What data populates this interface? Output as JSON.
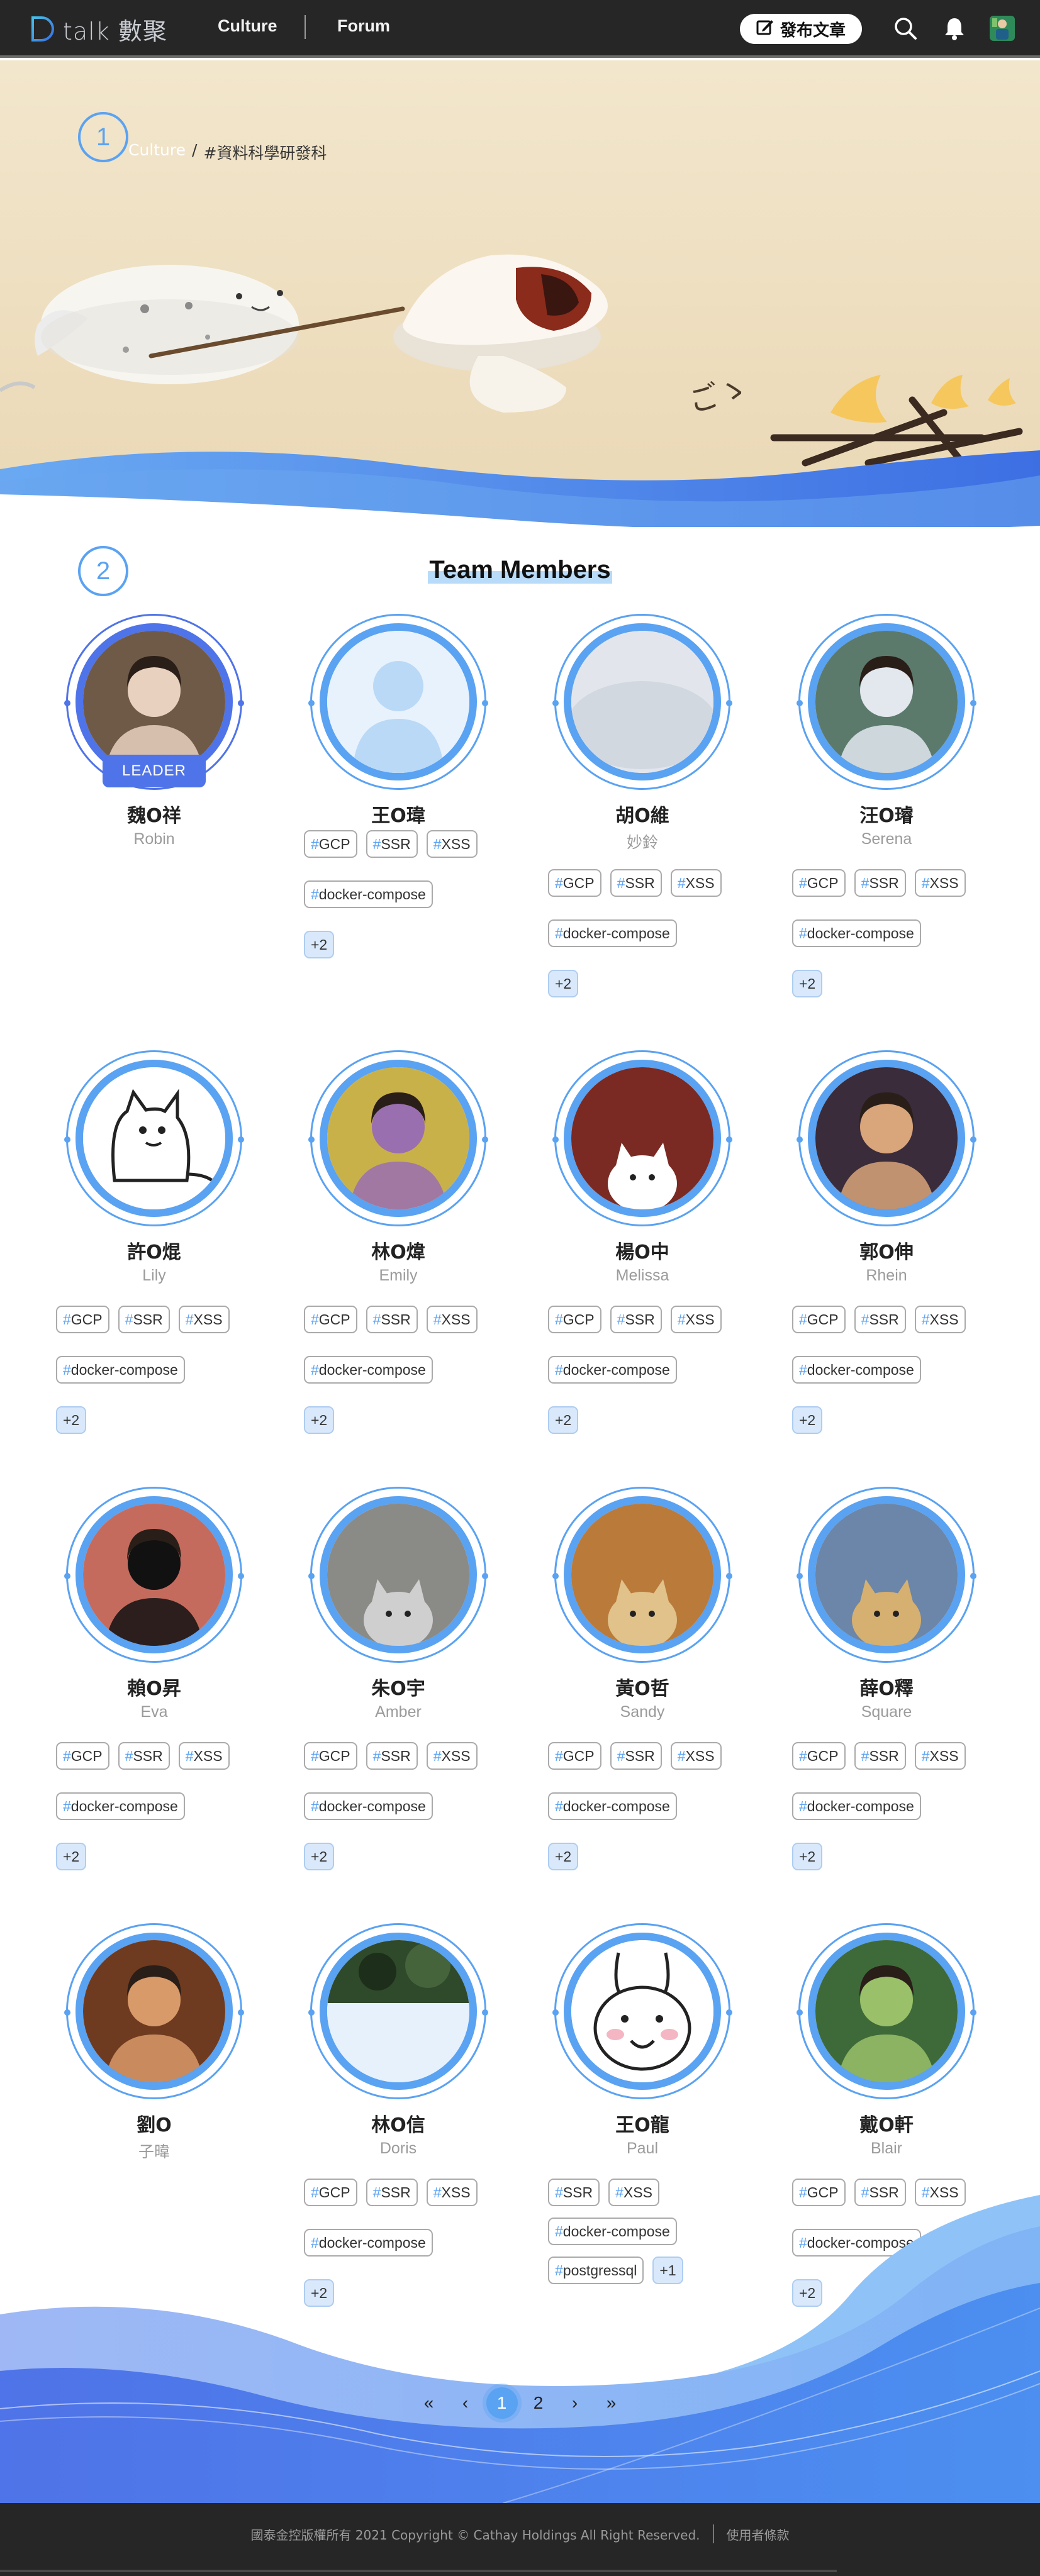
{
  "nav": {
    "logo_text": "talk 數聚",
    "links": [
      "Culture",
      "Forum"
    ],
    "publish_label": "發布文章"
  },
  "breadcrumb": {
    "root": "Culture",
    "separator": "/",
    "current": "#資料科學研發科"
  },
  "steps": [
    "1",
    "2"
  ],
  "team": {
    "title": "Team Members",
    "leader_label": "LEADER",
    "members": [
      {
        "name": "魏O祥",
        "nick": "Robin",
        "leader": true,
        "tags": [],
        "more": ""
      },
      {
        "name": "王O瑋",
        "nick": "",
        "tags": [
          "GCP",
          "SSR",
          "XSS",
          "docker-compose"
        ],
        "more": "+2"
      },
      {
        "name": "胡O維",
        "nick": "妙鈴",
        "tags": [
          "GCP",
          "SSR",
          "XSS",
          "docker-compose"
        ],
        "more": "+2"
      },
      {
        "name": "汪O璿",
        "nick": "Serena",
        "tags": [
          "GCP",
          "SSR",
          "XSS",
          "docker-compose"
        ],
        "more": "+2"
      },
      {
        "name": "許O焜",
        "nick": "Lily",
        "tags": [
          "GCP",
          "SSR",
          "XSS",
          "docker-compose"
        ],
        "more": "+2"
      },
      {
        "name": "林O煒",
        "nick": "Emily",
        "tags": [
          "GCP",
          "SSR",
          "XSS",
          "docker-compose"
        ],
        "more": "+2"
      },
      {
        "name": "楊O中",
        "nick": "Melissa",
        "tags": [
          "GCP",
          "SSR",
          "XSS",
          "docker-compose"
        ],
        "more": "+2"
      },
      {
        "name": "郭O伸",
        "nick": "Rhein",
        "tags": [
          "GCP",
          "SSR",
          "XSS",
          "docker-compose"
        ],
        "more": "+2"
      },
      {
        "name": "賴O昇",
        "nick": "Eva",
        "tags": [
          "GCP",
          "SSR",
          "XSS",
          "docker-compose"
        ],
        "more": "+2"
      },
      {
        "name": "朱O宇",
        "nick": "Amber",
        "tags": [
          "GCP",
          "SSR",
          "XSS",
          "docker-compose"
        ],
        "more": "+2"
      },
      {
        "name": "黃O哲",
        "nick": "Sandy",
        "tags": [
          "GCP",
          "SSR",
          "XSS",
          "docker-compose"
        ],
        "more": "+2"
      },
      {
        "name": "薛O釋",
        "nick": "Square",
        "tags": [
          "GCP",
          "SSR",
          "XSS",
          "docker-compose"
        ],
        "more": "+2"
      },
      {
        "name": "劉O",
        "nick": "子暐",
        "tags": [],
        "more": ""
      },
      {
        "name": "林O信",
        "nick": "Doris",
        "tags": [
          "GCP",
          "SSR",
          "XSS",
          "docker-compose"
        ],
        "more": "+2"
      },
      {
        "name": "王O龍",
        "nick": "Paul",
        "tags": [
          "SSR",
          "XSS",
          "docker-compose",
          "postgressql"
        ],
        "more": "+1"
      },
      {
        "name": "戴O軒",
        "nick": "Blair",
        "tags": [
          "GCP",
          "SSR",
          "XSS",
          "docker-compose"
        ],
        "more": "+2"
      }
    ]
  },
  "pagination": {
    "first": "«",
    "prev": "‹",
    "pages": [
      "1",
      "2"
    ],
    "current": "1",
    "next": "›",
    "last": "»"
  },
  "footer": {
    "copyright": "國泰金控版權所有 2021 Copyright © Cathay Holdings All Right Reserved.",
    "terms": "使用者條款"
  },
  "colors": {
    "accent": "#5aa2f2",
    "leader": "#4f73e8",
    "nav_bg": "#262626",
    "hero_bg": "#f1e3c6"
  }
}
